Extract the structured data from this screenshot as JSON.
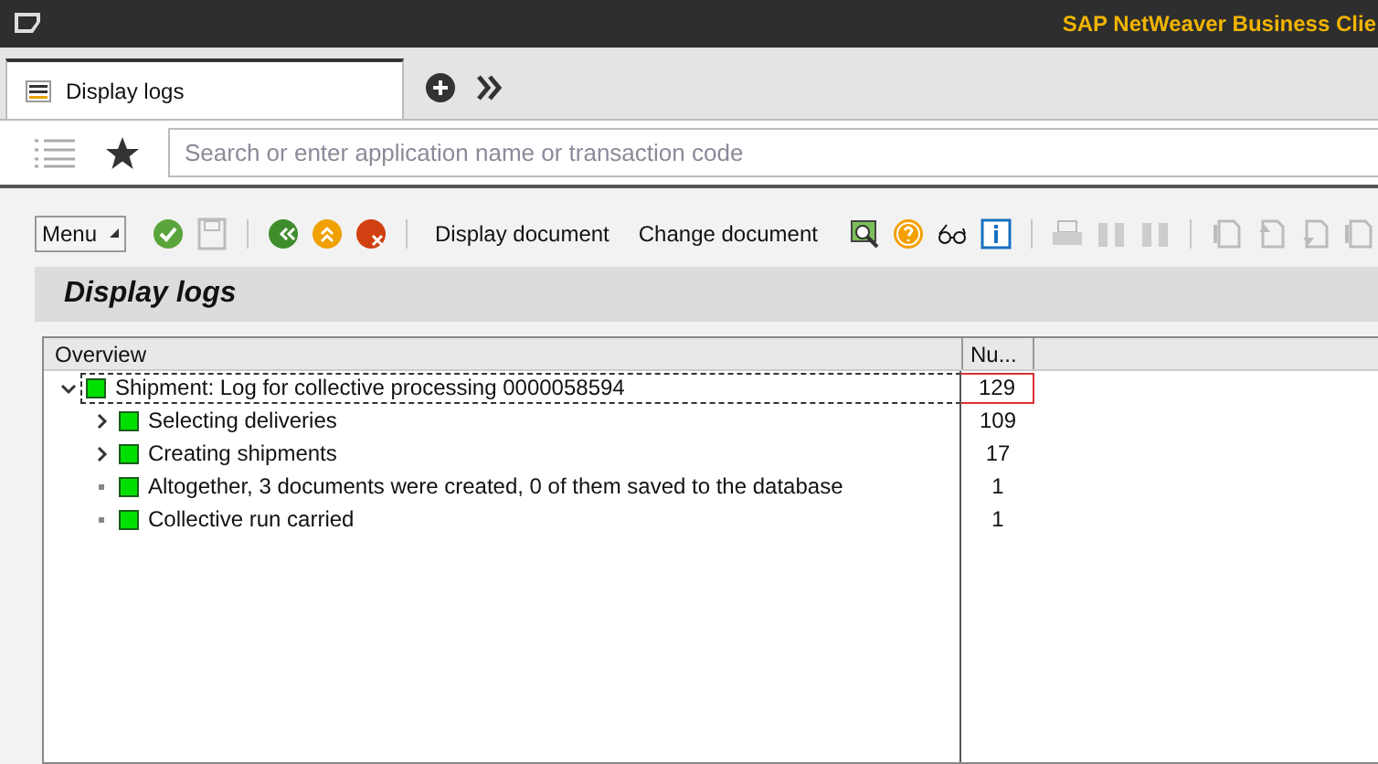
{
  "window": {
    "title": "SAP NetWeaver Business Clie"
  },
  "tabs": [
    {
      "label": "Display logs",
      "selected": true
    }
  ],
  "search": {
    "placeholder": "Search or enter application name or transaction code"
  },
  "toolbar": {
    "menu": "Menu",
    "buttons": [
      "Display document",
      "Change document"
    ]
  },
  "page_title": "Display logs",
  "tree": {
    "columns": [
      "Overview",
      "Nu..."
    ],
    "rows": [
      {
        "kind": "node",
        "expanded": true,
        "selected": true,
        "text": "Shipment: Log for collective processing 0000058594",
        "count": "129",
        "children": [
          {
            "kind": "node",
            "expanded": false,
            "selected": false,
            "text": "Selecting deliveries",
            "count": "109"
          },
          {
            "kind": "node",
            "expanded": false,
            "selected": false,
            "text": "Creating shipments",
            "count": "17"
          },
          {
            "kind": "leaf",
            "selected": false,
            "text": "Altogether, 3 documents were created, 0 of them saved to the database",
            "count": "1"
          },
          {
            "kind": "leaf",
            "selected": false,
            "text": "Collective run carried",
            "count": "1"
          }
        ]
      }
    ]
  }
}
